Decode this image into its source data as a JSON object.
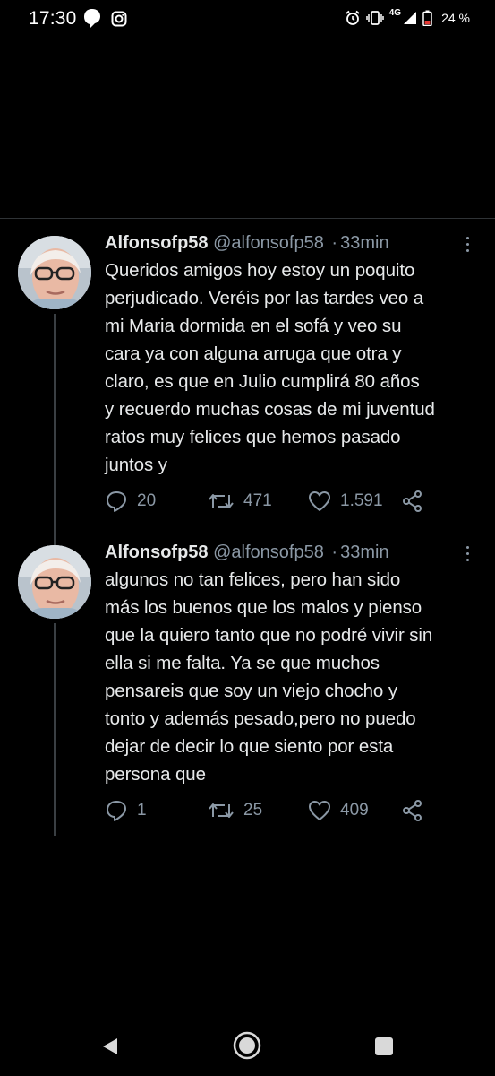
{
  "status_bar": {
    "time": "17:30",
    "network": "4G",
    "battery": "24 %",
    "icons": [
      "chat-bubble-icon",
      "instagram-icon",
      "alarm-icon",
      "vibrate-icon",
      "signal-icon",
      "battery-icon"
    ]
  },
  "tweets": [
    {
      "name": "Alfonsofp58",
      "handle": "@alfonsofp58",
      "separator": "·",
      "time": "33min",
      "text": "Queridos amigos hoy estoy un poquito\nperjudicado. Veréis por las tardes veo a\nmi Maria dormida en el sofá y veo su\ncara ya con alguna arruga que otra y\nclaro, es que en Julio cumplirá 80  años\ny recuerdo muchas cosas de mi juventud\nratos muy felices que hemos pasado\njuntos y",
      "replies": "20",
      "retweets": "471",
      "likes": "1.591"
    },
    {
      "name": "Alfonsofp58",
      "handle": "@alfonsofp58",
      "separator": "·",
      "time": "33min",
      "text": "algunos no tan felices, pero han sido\nmás los buenos que los malos y pienso\nque la quiero tanto que no podré vivir sin\nella si me falta. Ya se que muchos\npensareis que soy un viejo chocho y\ntonto y además pesado,pero no puedo\ndejar de decir lo que siento por esta\npersona que",
      "replies": "1",
      "retweets": "25",
      "likes": "409"
    }
  ],
  "colors": {
    "background": "#000000",
    "text_primary": "#e7e9ea",
    "text_secondary": "#8b98a5",
    "thread_line": "#3a3f43"
  }
}
